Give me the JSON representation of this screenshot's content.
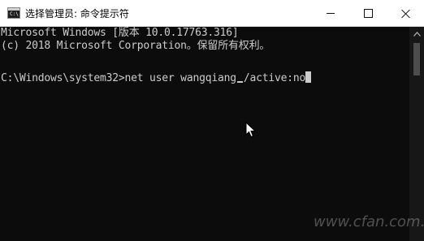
{
  "window": {
    "title": "选择管理员: 命令提示符",
    "icon_text": "C:\\",
    "icon": "cmd-icon"
  },
  "controls": {
    "minimize_icon": "minimize-icon",
    "maximize_icon": "maximize-icon",
    "close_icon": "close-icon"
  },
  "console": {
    "line1": "Microsoft Windows [版本 10.0.17763.316]",
    "line2": "(c) 2018 Microsoft Corporation。保留所有权利。",
    "prompt": "C:\\Windows\\system32>",
    "command_part1": "net user wangqiang",
    "command_part2": "/active:no"
  },
  "watermark": "www.cfan.com.cn",
  "colors": {
    "console_bg": "#0c0c0c",
    "console_text": "#cccccc",
    "titlebar_bg": "#ffffff"
  }
}
